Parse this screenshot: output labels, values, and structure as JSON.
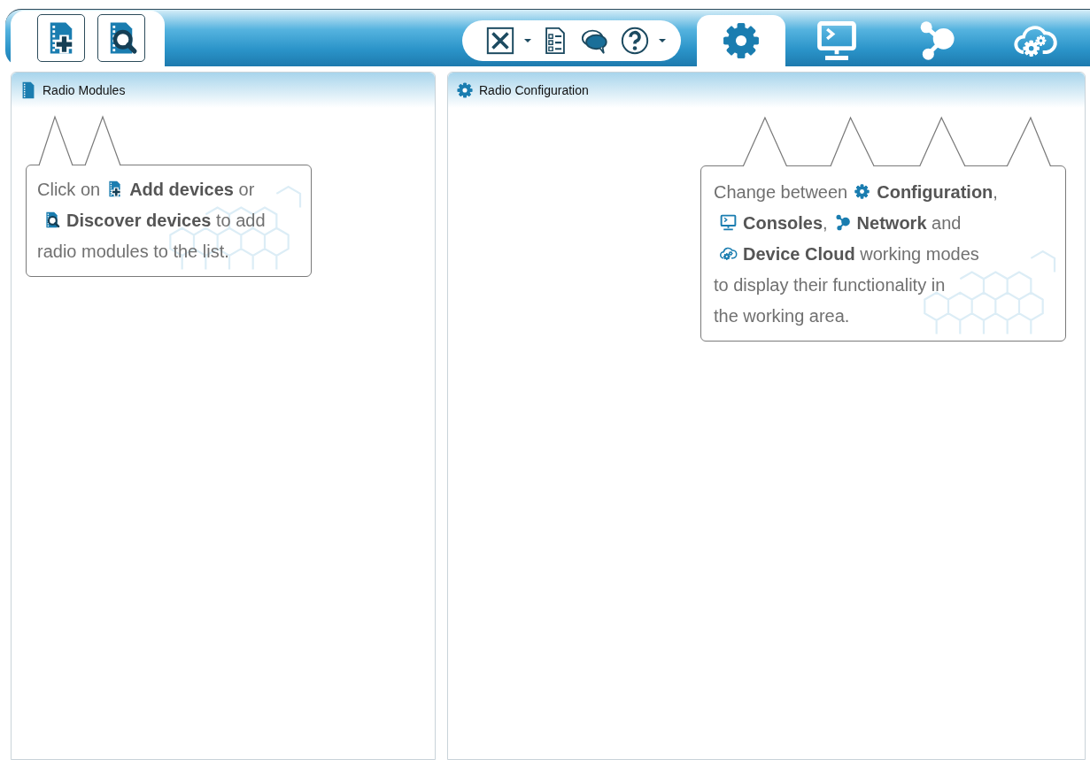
{
  "mode_tabs": [
    {
      "kind": "configuration",
      "selected": true
    },
    {
      "kind": "consoles",
      "selected": false
    },
    {
      "kind": "network",
      "selected": false
    },
    {
      "kind": "cloud",
      "selected": false
    }
  ],
  "panels": [
    {
      "kind": "modules",
      "title": "Radio Modules",
      "hint": {
        "lines": [
          [
            {
              "kind": "text",
              "text": "Click on"
            },
            {
              "kind": "add"
            },
            {
              "kind": "text",
              "text": "**Add devices** or"
            }
          ],
          [
            {
              "kind": "discover"
            },
            {
              "kind": "text",
              "text": "**Discover devices** to add"
            }
          ],
          [
            {
              "kind": "text",
              "text": "radio modules to the list."
            }
          ]
        ]
      }
    },
    {
      "kind": "configuration",
      "title": "Radio Configuration",
      "hint": {
        "lines": [
          [
            {
              "kind": "text",
              "text": "Change between"
            },
            {
              "kind": "configuration"
            },
            {
              "kind": "text",
              "text": "**Configuration**,"
            }
          ],
          [
            {
              "kind": "consoles"
            },
            {
              "kind": "text",
              "text": "**Consoles**,"
            },
            {
              "kind": "network"
            },
            {
              "kind": "text",
              "text": "**Network** and"
            }
          ],
          [
            {
              "kind": "cloud"
            },
            {
              "kind": "text",
              "text": "**Device Cloud** working modes"
            }
          ],
          [
            {
              "kind": "text",
              "text": "to display their functionality in"
            }
          ],
          [
            {
              "kind": "text",
              "text": "the working area."
            }
          ]
        ]
      }
    }
  ]
}
